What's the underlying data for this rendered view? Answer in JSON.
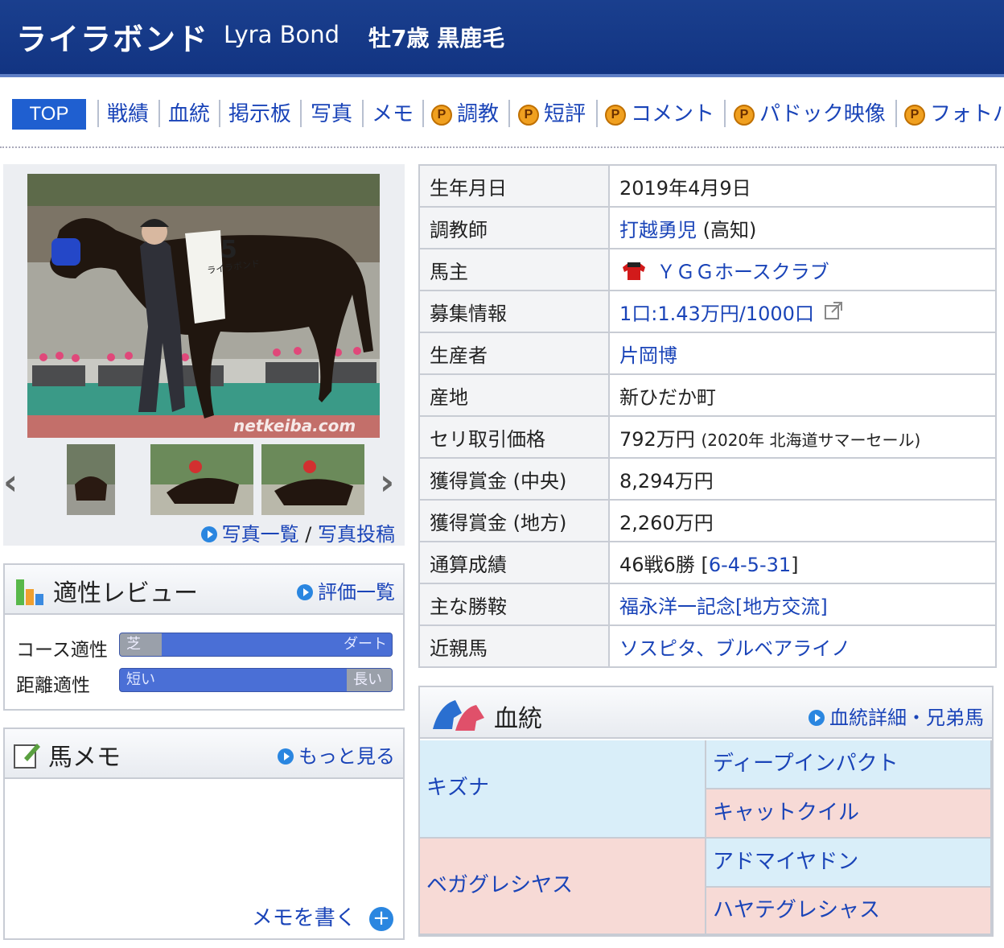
{
  "header": {
    "name_ja": "ライラボンド",
    "name_en": "Lyra Bond",
    "info": "牡7歳 黒鹿毛"
  },
  "nav": {
    "top": "TOP",
    "items": [
      "戦績",
      "血統",
      "掲示板",
      "写真",
      "メモ",
      "調教",
      "短評",
      "コメント",
      "パドック映像",
      "フォトパ"
    ],
    "premium_badge": "P"
  },
  "photo": {
    "watermark": "netkeiba.com",
    "saddle_number": "5",
    "saddle_name": "ライラボンド",
    "link_list": "写真一覧",
    "link_post": "写真投稿",
    "separator": "/"
  },
  "aptitude": {
    "title": "適性レビュー",
    "link": "評価一覧",
    "course_label": "コース適性",
    "course_left": "芝",
    "course_right": "ダート",
    "course_value": 0.85,
    "distance_label": "距離適性",
    "distance_left": "短い",
    "distance_right": "長い",
    "distance_value": 0.15
  },
  "memo": {
    "title": "馬メモ",
    "link": "もっと見る",
    "write": "メモを書く"
  },
  "info": {
    "birth_k": "生年月日",
    "birth_v": "2019年4月9日",
    "trainer_k": "調教師",
    "trainer_v": "打越勇児",
    "trainer_loc": "(高知)",
    "owner_k": "馬主",
    "owner_v": "ＹＧＧホースクラブ",
    "recruit_k": "募集情報",
    "recruit_v": "1口:1.43万円/1000口",
    "breeder_k": "生産者",
    "breeder_v": "片岡博",
    "origin_k": "産地",
    "origin_v": "新ひだか町",
    "auction_k": "セリ取引価格",
    "auction_v": "792万円",
    "auction_note": "(2020年 北海道サマーセール)",
    "prize_c_k": "獲得賞金 (中央)",
    "prize_c_v": "8,294万円",
    "prize_l_k": "獲得賞金 (地方)",
    "prize_l_v": "2,260万円",
    "record_k": "通算成績",
    "record_v": "46戦6勝",
    "record_detail": "6-4-5-31",
    "wins_k": "主な勝鞍",
    "wins_v": "福永洋一記念[地方交流]",
    "relatives_k": "近親馬",
    "relatives_v": "ソスピタ、ブルベアライノ"
  },
  "pedigree": {
    "title": "血統",
    "link": "血統詳細・兄弟馬",
    "sire": "キズナ",
    "sire_sire": "ディープインパクト",
    "sire_dam": "キャットクイル",
    "dam": "ベガグレシヤス",
    "dam_sire": "アドマイヤドン",
    "dam_dam": "ハヤテグレシャス"
  }
}
